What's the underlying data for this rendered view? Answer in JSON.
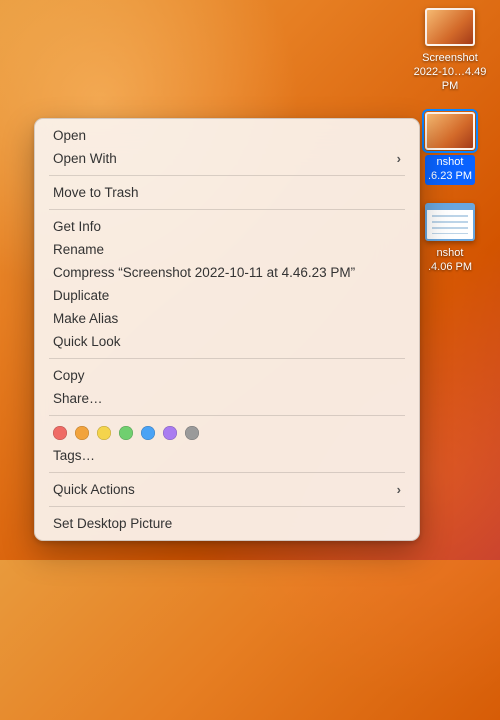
{
  "desktop": {
    "icons": [
      {
        "label": "Screenshot\n2022-10…4.49 PM",
        "selected": false,
        "kind": "image"
      },
      {
        "label": "nshot\n.6.23 PM",
        "selected": true,
        "kind": "image"
      },
      {
        "label": "nshot\n.4.06 PM",
        "selected": false,
        "kind": "window"
      }
    ],
    "partial_labels": [
      "M",
      "M"
    ]
  },
  "context_menu": {
    "groups": [
      [
        {
          "label": "Open",
          "submenu": false
        },
        {
          "label": "Open With",
          "submenu": true
        }
      ],
      [
        {
          "label": "Move to Trash",
          "submenu": false
        }
      ],
      [
        {
          "label": "Get Info",
          "submenu": false
        },
        {
          "label": "Rename",
          "submenu": false
        },
        {
          "label": "Compress “Screenshot 2022-10-11 at 4.46.23 PM”",
          "submenu": false
        },
        {
          "label": "Duplicate",
          "submenu": false
        },
        {
          "label": "Make Alias",
          "submenu": false
        },
        {
          "label": "Quick Look",
          "submenu": false
        }
      ],
      [
        {
          "label": "Copy",
          "submenu": false
        },
        {
          "label": "Share…",
          "submenu": false
        }
      ]
    ],
    "tag_colors": [
      "#ef6b65",
      "#f2a33c",
      "#f4d44c",
      "#70cf6f",
      "#4aa3f5",
      "#a97cf0",
      "#9a9a9a"
    ],
    "tags_label": "Tags…",
    "quick_actions_label": "Quick Actions",
    "set_desktop_label": "Set Desktop Picture"
  }
}
